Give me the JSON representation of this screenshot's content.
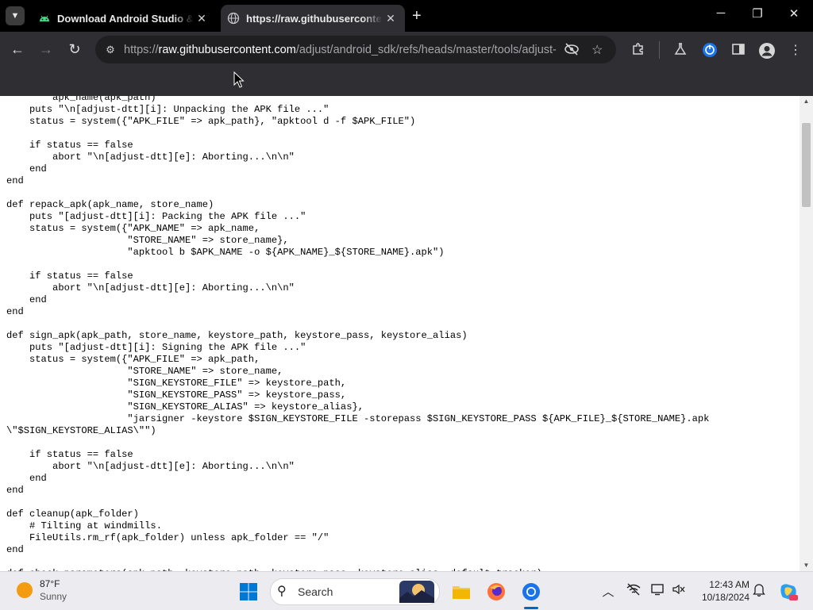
{
  "tabs": [
    {
      "title": "Download Android Studio & App Tools - Android Developers",
      "active": false,
      "favicon": "android-icon"
    },
    {
      "title": "https://raw.githubusercontent.com/adjust/android_sdk/refs/heads/master/tools/adjust-dtt",
      "active": true,
      "favicon": "globe-icon"
    }
  ],
  "url": {
    "scheme": "https://",
    "host": "raw.githubusercontent.com",
    "path": "/adjust/android_sdk/refs/heads/master/tools/adjust-..."
  },
  "code_lines": [
    "        apk_name(apk_path)",
    "    puts \"\\n[adjust-dtt][i]: Unpacking the APK file ...\"",
    "    status = system({\"APK_FILE\" => apk_path}, \"apktool d -f $APK_FILE\")",
    "",
    "    if status == false",
    "        abort \"\\n[adjust-dtt][e]: Aborting...\\n\\n\"",
    "    end",
    "end",
    "",
    "def repack_apk(apk_name, store_name)",
    "    puts \"[adjust-dtt][i]: Packing the APK file ...\"",
    "    status = system({\"APK_NAME\" => apk_name,",
    "                     \"STORE_NAME\" => store_name},",
    "                     \"apktool b $APK_NAME -o ${APK_NAME}_${STORE_NAME}.apk\")",
    "",
    "    if status == false",
    "        abort \"\\n[adjust-dtt][e]: Aborting...\\n\\n\"",
    "    end",
    "end",
    "",
    "def sign_apk(apk_path, store_name, keystore_path, keystore_pass, keystore_alias)",
    "    puts \"[adjust-dtt][i]: Signing the APK file ...\"",
    "    status = system({\"APK_FILE\" => apk_path,",
    "                     \"STORE_NAME\" => store_name,",
    "                     \"SIGN_KEYSTORE_FILE\" => keystore_path,",
    "                     \"SIGN_KEYSTORE_PASS\" => keystore_pass,",
    "                     \"SIGN_KEYSTORE_ALIAS\" => keystore_alias},",
    "                     \"jarsigner -keystore $SIGN_KEYSTORE_FILE -storepass $SIGN_KEYSTORE_PASS ${APK_FILE}_${STORE_NAME}.apk",
    "\\\"$SIGN_KEYSTORE_ALIAS\\\"\")",
    "",
    "    if status == false",
    "        abort \"\\n[adjust-dtt][e]: Aborting...\\n\\n\"",
    "    end",
    "end",
    "",
    "def cleanup(apk_folder)",
    "    # Tilting at windmills.",
    "    FileUtils.rm_rf(apk_folder) unless apk_folder == \"/\"",
    "end",
    "",
    "def check_parameters(apk_path, keystore_path, keystore_pass, keystore_alias, default_tracker)"
  ],
  "taskbar": {
    "temperature": "87°F",
    "condition": "Sunny",
    "search_label": "Search",
    "time": "12:43 AM",
    "date": "10/18/2024"
  },
  "colors": {
    "tab_strip": "#000000",
    "toolbar": "#2f2f33",
    "omnibox": "#1f1f22",
    "taskbar": "#ececf0",
    "accent": "#0067c0"
  }
}
